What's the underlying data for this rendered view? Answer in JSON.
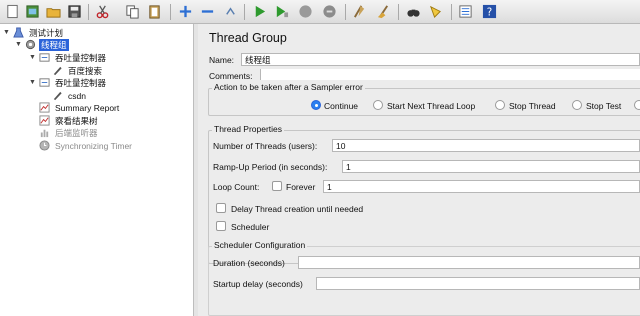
{
  "tree": {
    "root": "测试计划",
    "thread_group": "线程组",
    "controller1": "吞吐量控制器",
    "sampler1": "百度搜索",
    "controller2": "吞吐量控制器",
    "sampler2": "csdn",
    "summary_report": "Summary Report",
    "view_results": "察看结果树",
    "backend_listener": "后端监听器",
    "sync_timer": "Synchronizing Timer"
  },
  "panel": {
    "title": "Thread Group",
    "name_label": "Name:",
    "name_value": "线程组",
    "comments_label": "Comments:",
    "comments_value": "",
    "error_action": {
      "legend": "Action to be taken after a Sampler error",
      "options": [
        "Continue",
        "Start Next Thread Loop",
        "Stop Thread",
        "Stop Test"
      ],
      "selected": "Continue"
    },
    "thread_props": {
      "legend": "Thread Properties",
      "threads_label": "Number of Threads (users):",
      "threads_value": "10",
      "rampup_label": "Ramp-Up Period (in seconds):",
      "rampup_value": "1",
      "loop_label": "Loop Count:",
      "forever_label": "Forever",
      "forever_checked": false,
      "loop_value": "1",
      "delay_label": "Delay Thread creation until needed",
      "delay_checked": false,
      "scheduler_label": "Scheduler",
      "scheduler_checked": false
    },
    "scheduler_config": {
      "legend": "Scheduler Configuration",
      "duration_label": "Duration (seconds)",
      "duration_value": "",
      "startup_label": "Startup delay (seconds)",
      "startup_value": ""
    }
  },
  "toolbar_icons": [
    "new-icon",
    "templates-icon",
    "open-icon",
    "save-icon",
    "cut-icon",
    "copy-icon",
    "paste-icon",
    "expand-icon",
    "collapse-icon",
    "toggle-icon",
    "start-icon",
    "start-no-pauses-icon",
    "stop-icon",
    "shutdown-icon",
    "remote-start-icon",
    "clear-icon",
    "clear-all-icon",
    "search-icon",
    "reset-search-icon",
    "function-helper-icon",
    "help-icon"
  ],
  "colors": {
    "selection": "#2b63d9",
    "radio_on": "#2b7ff0"
  }
}
